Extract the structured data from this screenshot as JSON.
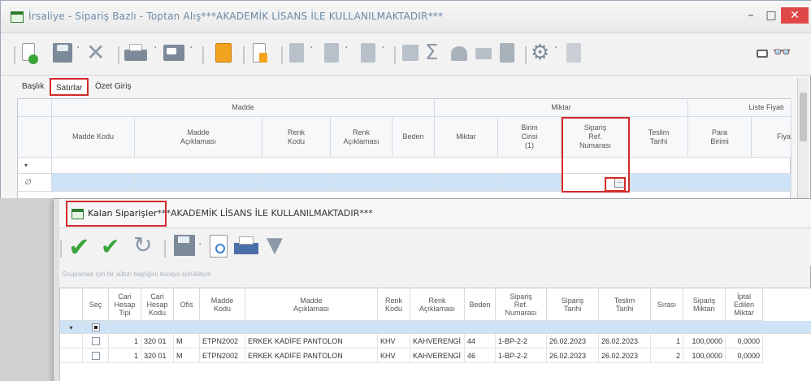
{
  "window": {
    "title": "İrsaliye - Sipariş Bazlı - Toptan Alış***AKADEMİK LİSANS İLE KULLANILMAKTADIR***",
    "min": "–",
    "max": "□",
    "close": "✕"
  },
  "toolbar_icons": [
    "new-doc-icon",
    "save-icon",
    "delete-icon",
    "print-icon",
    "print-preview-icon",
    "copy-icon",
    "attachment-icon",
    "tool-icon-1",
    "tool-icon-2",
    "tool-icon-3",
    "tool-icon-4",
    "sum-icon",
    "tool-icon-5",
    "tool-icon-6",
    "tool-icon-7",
    "settings-icon",
    "tool-icon-8",
    "window-icon",
    "binoculars-icon"
  ],
  "tabs": [
    "Başlık",
    "Satırlar",
    "Özet Giriş"
  ],
  "top_grid": {
    "bands": {
      "madde": "Madde",
      "miktar": "Miktar",
      "liste_fiyati": "Liste Fiyatı"
    },
    "columns": [
      "Madde Kodu",
      "Madde Açıklaması",
      "Renk Kodu",
      "Renk Açıklaması",
      "Beden",
      "Miktar",
      "Birim Cinsi (1)",
      "Sipariş Ref. Numarası",
      "Teslim Tarihi",
      "Para Birimi",
      "Fiya"
    ],
    "row_markers": [
      "▾",
      "∅"
    ],
    "ellipsis": "..."
  },
  "popup": {
    "title": "Kalan Siparişler",
    "title_suffix": "***AKADEMİK LİSANS İLE KULLANILMAKTADIR***",
    "toolbar_icons": [
      "check-icon",
      "check-all-icon",
      "refresh-icon",
      "save-icon",
      "preview-icon",
      "print-icon",
      "filter-icon"
    ],
    "group_hint": "Gruplamak için bir sütun başlığını buraya sürükleyin",
    "columns": [
      "Seç",
      "Cari Hesap Tipi",
      "Cari Hesap Kodu",
      "Ofis",
      "Madde Kodu",
      "Madde Açıklaması",
      "Renk Kodu",
      "Renk Açıklaması",
      "Beden",
      "Sipariş Ref. Numarası",
      "Sipariş Tarihi",
      "Teslim Tarihi",
      "Sırası",
      "Sipariş Miktarı",
      "İptal Edilen Miktar"
    ],
    "filter_marker": "▾",
    "rows": [
      [
        "",
        "1",
        "320 01",
        "M",
        "ETPN2002",
        "ERKEK KADİFE PANTOLON",
        "KHV",
        "KAHVERENGİ",
        "44",
        "1-BP-2-2",
        "26.02.2023",
        "26.02.2023",
        "1",
        "100,0000",
        "0,0000"
      ],
      [
        "",
        "1",
        "320 01",
        "M",
        "ETPN2002",
        "ERKEK KADİFE PANTOLON",
        "KHV",
        "KAHVERENGİ",
        "46",
        "1-BP-2-2",
        "26.02.2023",
        "26.02.2023",
        "2",
        "100,0000",
        "0,0000"
      ]
    ]
  }
}
